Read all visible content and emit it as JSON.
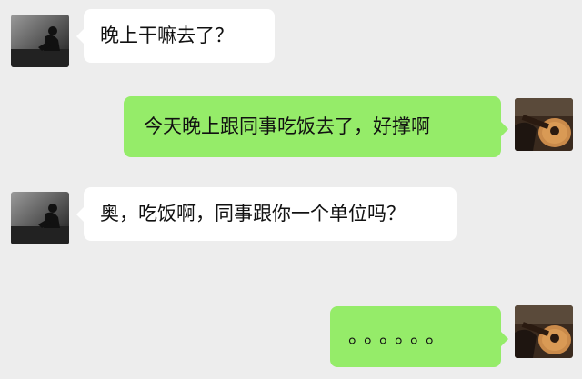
{
  "colors": {
    "background": "#ededed",
    "incoming_bubble": "#ffffff",
    "outgoing_bubble": "#95ec69"
  },
  "messages": [
    {
      "direction": "incoming",
      "avatar": "silhouette-avatar",
      "text": "晚上干嘛去了？"
    },
    {
      "direction": "outgoing",
      "avatar": "guitar-avatar",
      "text": "今天晚上跟同事吃饭去了，好撑啊"
    },
    {
      "direction": "incoming",
      "avatar": "silhouette-avatar",
      "text": "奥，吃饭啊，同事跟你一个单位吗？"
    },
    {
      "direction": "outgoing",
      "avatar": "guitar-avatar",
      "text": "。。。。。。"
    }
  ]
}
